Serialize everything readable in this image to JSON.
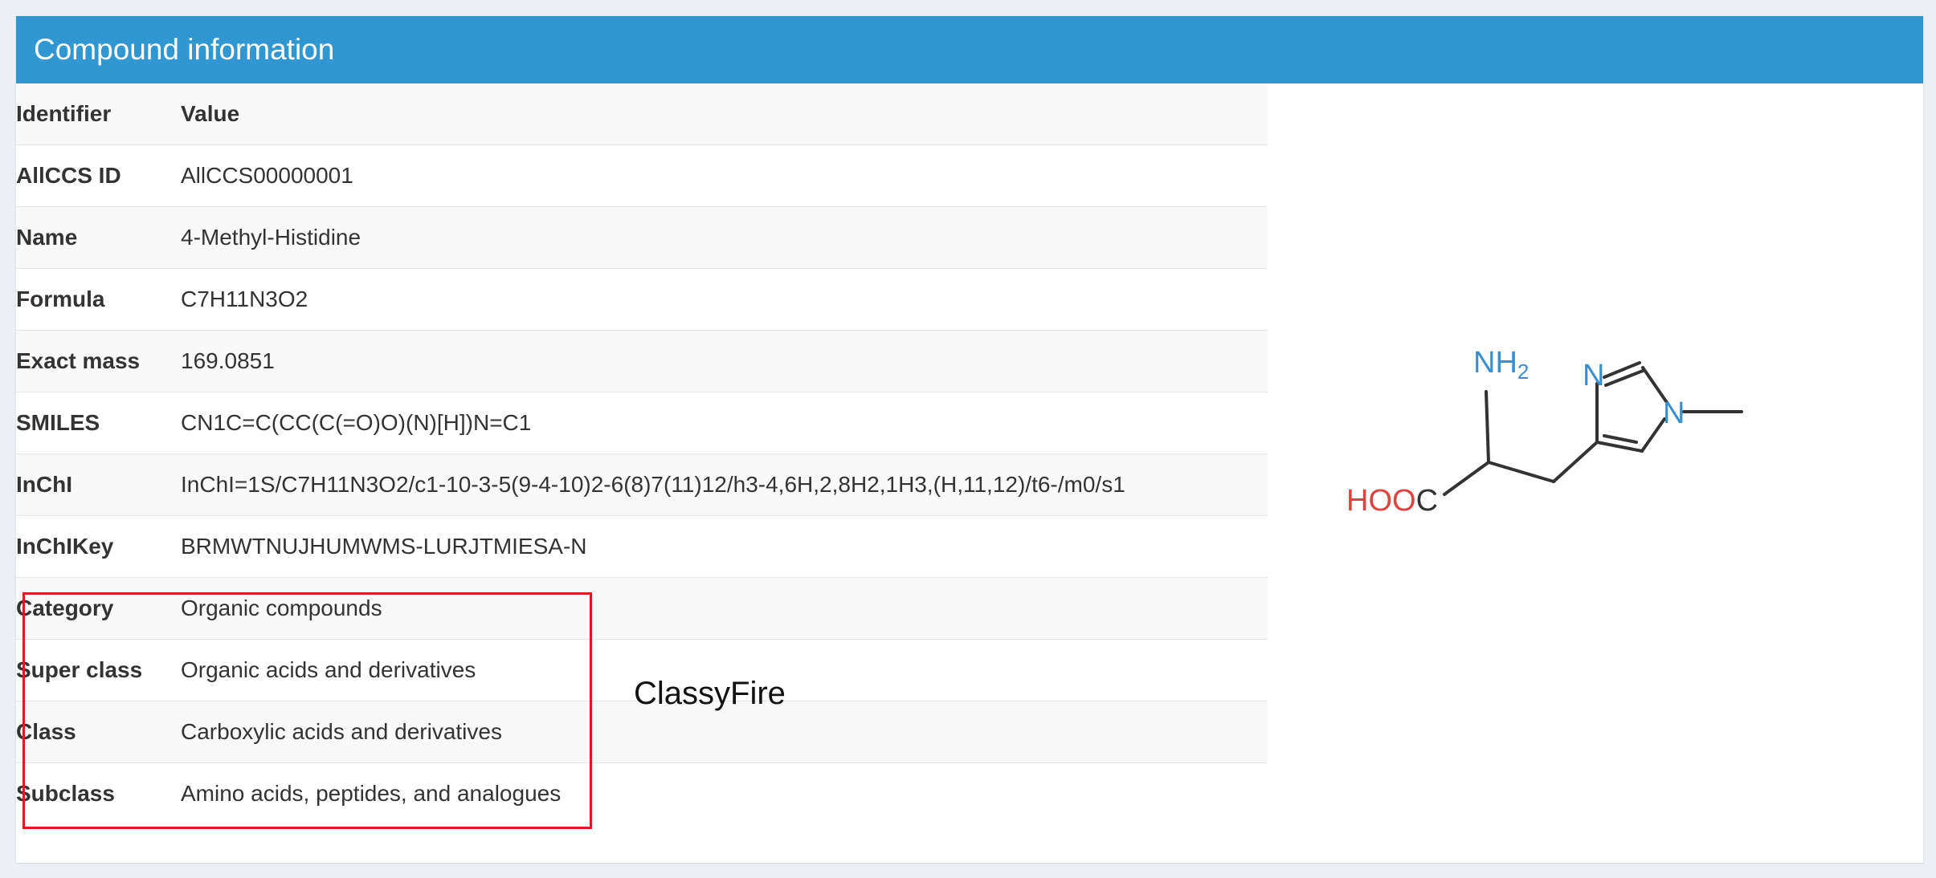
{
  "header": {
    "title": "Compound information"
  },
  "table": {
    "columns": {
      "key": "Identifier",
      "value": "Value"
    },
    "rows": [
      {
        "key": "AllCCS ID",
        "value": "AllCCS00000001"
      },
      {
        "key": "Name",
        "value": "4-Methyl-Histidine"
      },
      {
        "key": "Formula",
        "value": "C7H11N3O2"
      },
      {
        "key": "Exact mass",
        "value": "169.0851"
      },
      {
        "key": "SMILES",
        "value": "CN1C=C(CC(C(=O)O)(N)[H])N=C1"
      },
      {
        "key": "InChI",
        "value": "InChI=1S/C7H11N3O2/c1-10-3-5(9-4-10)2-6(8)7(11)12/h3-4,6H,2,8H2,1H3,(H,11,12)/t6-/m0/s1"
      },
      {
        "key": "InChIKey",
        "value": "BRMWTNUJHUMWMS-LURJTMIESA-N"
      },
      {
        "key": "Category",
        "value": "Organic compounds"
      },
      {
        "key": "Super class",
        "value": "Organic acids and derivatives"
      },
      {
        "key": "Class",
        "value": "Carboxylic acids and derivatives"
      },
      {
        "key": "Subclass",
        "value": "Amino acids, peptides, and analogues"
      }
    ]
  },
  "annotation": {
    "label": "ClassyFire",
    "color": "#e11a1a"
  },
  "structure": {
    "atoms": {
      "nh2_main": "NH",
      "nh2_sub": "2",
      "hooc_red": "HOO",
      "hooc_black": "C",
      "n_ring1": "N",
      "n_ring2": "N"
    },
    "colors": {
      "nitrogen": "#3a8fd0",
      "oxygen": "#e0423d",
      "carbon": "#333333"
    }
  }
}
